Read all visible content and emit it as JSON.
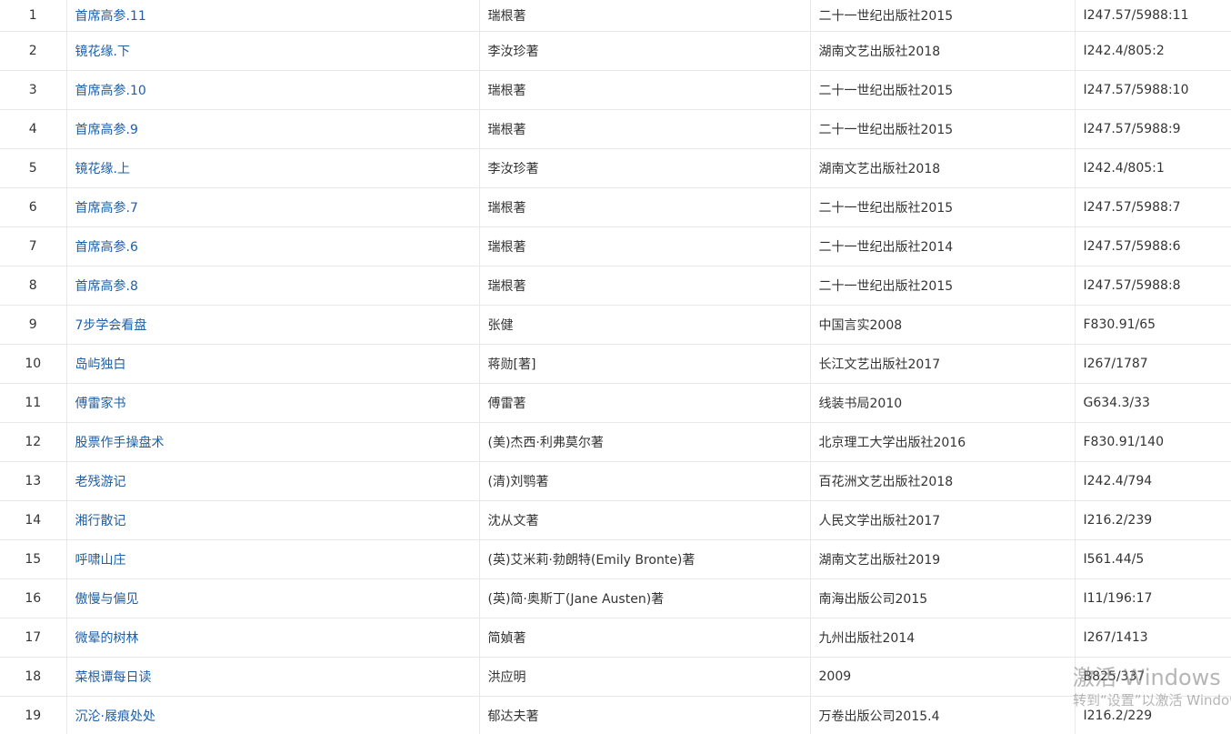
{
  "books": [
    {
      "no": "1",
      "title": "首席高参.11",
      "author": "瑞根著",
      "publisher": "二十一世纪出版社2015",
      "call_no": "I247.57/5988:11"
    },
    {
      "no": "2",
      "title": "镜花缘.下",
      "author": "李汝珍著",
      "publisher": "湖南文艺出版社2018",
      "call_no": "I242.4/805:2"
    },
    {
      "no": "3",
      "title": "首席高参.10",
      "author": "瑞根著",
      "publisher": "二十一世纪出版社2015",
      "call_no": "I247.57/5988:10"
    },
    {
      "no": "4",
      "title": "首席高参.9",
      "author": "瑞根著",
      "publisher": "二十一世纪出版社2015",
      "call_no": "I247.57/5988:9"
    },
    {
      "no": "5",
      "title": "镜花缘.上",
      "author": "李汝珍著",
      "publisher": "湖南文艺出版社2018",
      "call_no": "I242.4/805:1"
    },
    {
      "no": "6",
      "title": "首席高参.7",
      "author": "瑞根著",
      "publisher": "二十一世纪出版社2015",
      "call_no": "I247.57/5988:7"
    },
    {
      "no": "7",
      "title": "首席高参.6",
      "author": "瑞根著",
      "publisher": "二十一世纪出版社2014",
      "call_no": "I247.57/5988:6"
    },
    {
      "no": "8",
      "title": "首席高参.8",
      "author": "瑞根著",
      "publisher": "二十一世纪出版社2015",
      "call_no": "I247.57/5988:8"
    },
    {
      "no": "9",
      "title": "7步学会看盘",
      "author": "张健",
      "publisher": "中国言实2008",
      "call_no": "F830.91/65"
    },
    {
      "no": "10",
      "title": "岛屿独白",
      "author": "蒋勋[著]",
      "publisher": "长江文艺出版社2017",
      "call_no": "I267/1787"
    },
    {
      "no": "11",
      "title": "傅雷家书",
      "author": "傅雷著",
      "publisher": "线装书局2010",
      "call_no": "G634.3/33"
    },
    {
      "no": "12",
      "title": "股票作手操盘术",
      "author": "(美)杰西·利弗莫尔著",
      "publisher": "北京理工大学出版社2016",
      "call_no": "F830.91/140"
    },
    {
      "no": "13",
      "title": "老残游记",
      "author": "(清)刘鹗著",
      "publisher": "百花洲文艺出版社2018",
      "call_no": "I242.4/794"
    },
    {
      "no": "14",
      "title": "湘行散记",
      "author": "沈从文著",
      "publisher": "人民文学出版社2017",
      "call_no": "I216.2/239"
    },
    {
      "no": "15",
      "title": "呼啸山庄",
      "author": "(英)艾米莉·勃朗特(Emily Bronte)著",
      "publisher": "湖南文艺出版社2019",
      "call_no": "I561.44/5"
    },
    {
      "no": "16",
      "title": "傲慢与偏见",
      "author": "(英)简·奥斯丁(Jane Austen)著",
      "publisher": "南海出版公司2015",
      "call_no": "I11/196:17"
    },
    {
      "no": "17",
      "title": "微晕的树林",
      "author": "简媜著",
      "publisher": "九州出版社2014",
      "call_no": "I267/1413"
    },
    {
      "no": "18",
      "title": "菜根谭每日读",
      "author": "洪应明",
      "publisher": "2009",
      "call_no": "B825/337"
    },
    {
      "no": "19",
      "title": "沉沦·屐痕处处",
      "author": "郁达夫著",
      "publisher": "万卷出版公司2015.4",
      "call_no": "I216.2/229"
    }
  ],
  "watermark": {
    "title": "激活 Windows",
    "subtitle": "转到“设置”以激活 Windows。"
  },
  "colors": {
    "link": "#1e5fa8",
    "text": "#333333",
    "border": "#e8e8e8"
  }
}
